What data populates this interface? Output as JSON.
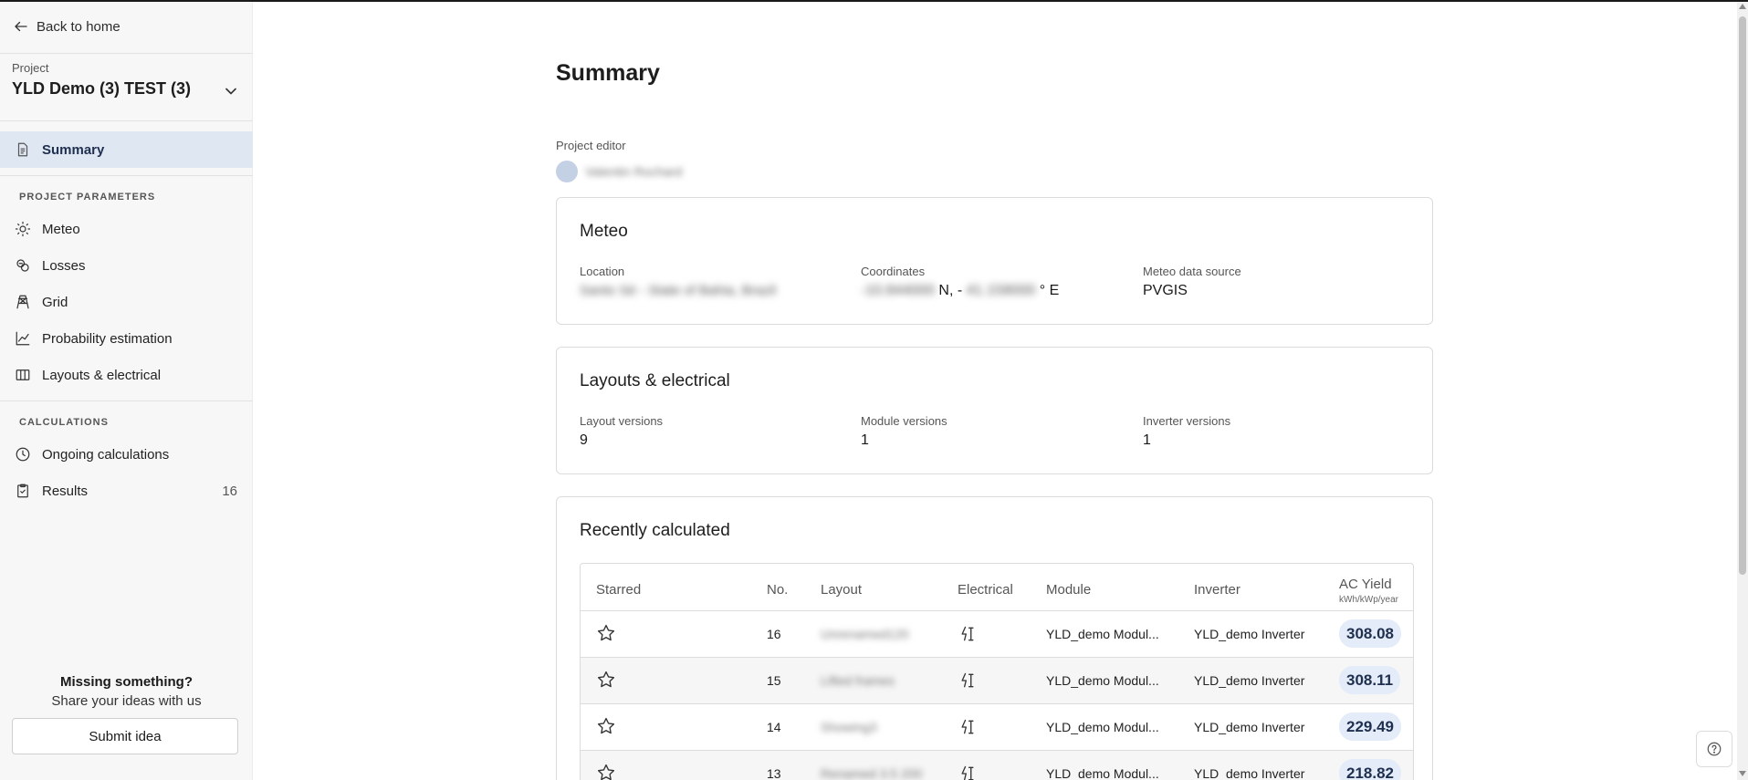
{
  "sidebar": {
    "back_label": "Back to home",
    "project_label": "Project",
    "project_name": "YLD Demo (3) TEST (3)",
    "summary_label": "Summary",
    "section_project_parameters": "PROJECT PARAMETERS",
    "params": [
      {
        "label": "Meteo",
        "icon": "sun-icon"
      },
      {
        "label": "Losses",
        "icon": "losses-icon"
      },
      {
        "label": "Grid",
        "icon": "pylon-icon"
      },
      {
        "label": "Probability estimation",
        "icon": "line-chart-icon"
      },
      {
        "label": "Layouts & electrical",
        "icon": "columns-icon"
      }
    ],
    "section_calculations": "CALCULATIONS",
    "calcs": [
      {
        "label": "Ongoing calculations",
        "icon": "clock-icon",
        "count": ""
      },
      {
        "label": "Results",
        "icon": "clipboard-check-icon",
        "count": "16"
      }
    ],
    "missing_title": "Missing something?",
    "missing_sub": "Share your ideas with us",
    "submit_label": "Submit idea"
  },
  "main": {
    "title": "Summary",
    "editor_label": "Project editor",
    "editor_name": "Valentin Rochard",
    "meteo": {
      "title": "Meteo",
      "location_label": "Location",
      "location_value": "Santo Sé - State of Bahia, Brazil",
      "coordinates_label": "Coordinates",
      "coord_lat": "-10.844000",
      "coord_n": "N, -",
      "coord_lon": "41.158000",
      "coord_e": "° E",
      "source_label": "Meteo data source",
      "source_value": "PVGIS"
    },
    "layouts": {
      "title": "Layouts & electrical",
      "layout_label": "Layout versions",
      "layout_value": "9",
      "module_label": "Module versions",
      "module_value": "1",
      "inverter_label": "Inverter versions",
      "inverter_value": "1"
    },
    "recent": {
      "title": "Recently calculated",
      "headers": {
        "starred": "Starred",
        "no": "No.",
        "layout": "Layout",
        "electrical": "Electrical",
        "module": "Module",
        "inverter": "Inverter",
        "ac_yield": "AC Yield",
        "ac_yield_unit": "kWh/kWp/year"
      },
      "rows": [
        {
          "no": "16",
          "layout": "Unrenamed120",
          "module": "YLD_demo Modul...",
          "inverter": "YLD_demo Inverter",
          "yield": "308.08"
        },
        {
          "no": "15",
          "layout": "Lifted frames",
          "module": "YLD_demo Modul...",
          "inverter": "YLD_demo Inverter",
          "yield": "308.11"
        },
        {
          "no": "14",
          "layout": "Showing3",
          "module": "YLD_demo Modul...",
          "inverter": "YLD_demo Inverter",
          "yield": "229.49"
        },
        {
          "no": "13",
          "layout": "Renamed 3.5 200",
          "module": "YLD_demo Modul...",
          "inverter": "YLD_demo Inverter",
          "yield": "218.82"
        }
      ]
    }
  },
  "colors": {
    "active_nav_bg": "#dfe7f3",
    "yield_badge_bg": "#e3ecf8",
    "sidebar_bg": "#f7f7f7"
  }
}
